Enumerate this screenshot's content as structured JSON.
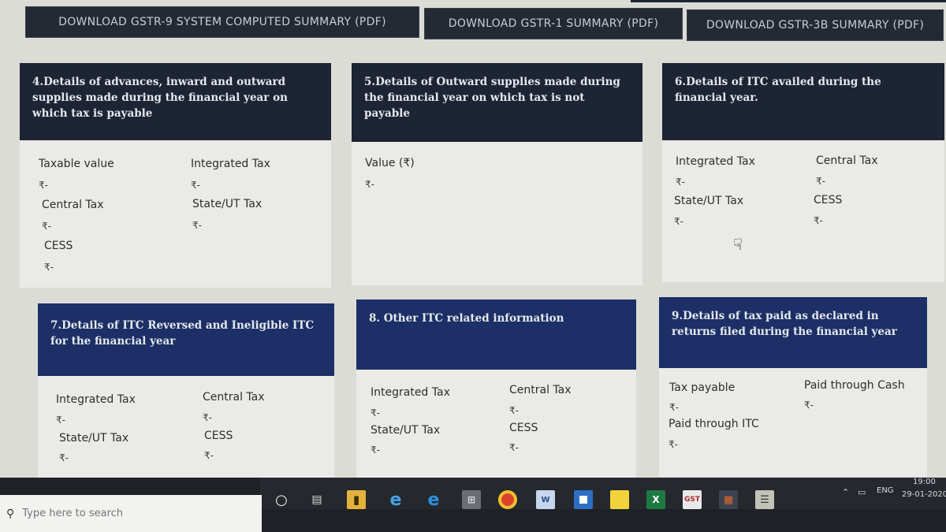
{
  "downloads": {
    "gstr9": "DOWNLOAD GSTR-9 SYSTEM COMPUTED SUMMARY (PDF)",
    "gstr1": "DOWNLOAD GSTR-1 SUMMARY (PDF)",
    "gstr3b": "DOWNLOAD GSTR-3B SUMMARY (PDF)"
  },
  "cards": {
    "c4": {
      "title": "4.Details of advances, inward and outward supplies made during the financial year on which tax is payable",
      "fields": {
        "taxable_value": "Taxable value",
        "taxable_value_amt": "₹-",
        "integrated_tax": "Integrated Tax",
        "integrated_tax_amt": "₹-",
        "central_tax": "Central Tax",
        "central_tax_amt": "₹-",
        "state_ut_tax": "State/UT Tax",
        "state_ut_tax_amt": "₹-",
        "cess": "CESS",
        "cess_amt": "₹-"
      }
    },
    "c5": {
      "title": "5.Details of Outward supplies made during the financial year on which tax is not payable",
      "fields": {
        "value": "Value (₹)",
        "value_amt": "₹-"
      }
    },
    "c6": {
      "title": "6.Details of ITC availed during the financial year.",
      "fields": {
        "integrated_tax": "Integrated Tax",
        "integrated_tax_amt": "₹-",
        "central_tax": "Central Tax",
        "central_tax_amt": "₹-",
        "state_ut_tax": "State/UT Tax",
        "state_ut_tax_amt": "₹-",
        "cess": "CESS",
        "cess_amt": "₹-"
      }
    },
    "c7": {
      "title": "7.Details of ITC Reversed and Ineligible ITC for the financial year",
      "fields": {
        "integrated_tax": "Integrated Tax",
        "integrated_tax_amt": "₹-",
        "central_tax": "Central Tax",
        "central_tax_amt": "₹-",
        "state_ut_tax": "State/UT Tax",
        "state_ut_tax_amt": "₹-",
        "cess": "CESS",
        "cess_amt": "₹-"
      }
    },
    "c8": {
      "title": "8. Other ITC related information",
      "fields": {
        "integrated_tax": "Integrated Tax",
        "integrated_tax_amt": "₹-",
        "central_tax": "Central Tax",
        "central_tax_amt": "₹-",
        "state_ut_tax": "State/UT Tax",
        "state_ut_tax_amt": "₹-",
        "cess": "CESS",
        "cess_amt": "₹-"
      }
    },
    "c9": {
      "title": "9.Details of tax paid as declared in returns filed during the financial year",
      "fields": {
        "tax_payable": "Tax payable",
        "tax_payable_amt": "₹-",
        "paid_cash": "Paid through Cash",
        "paid_cash_amt": "₹-",
        "paid_itc": "Paid through ITC",
        "paid_itc_amt": "₹-"
      }
    }
  },
  "taskbar": {
    "search_placeholder": "Type here to search",
    "lang": "ENG",
    "time": "19:00",
    "date": "29-01-2020",
    "apps": [
      "cortana-icon",
      "task-view-icon",
      "file-explorer-icon",
      "ie-icon",
      "edge-icon",
      "calculator-icon",
      "chrome-icon",
      "word-icon",
      "app-icon",
      "sticky-notes-icon",
      "excel-icon",
      "gst-app-icon",
      "store-icon",
      "reader-icon"
    ]
  },
  "colors": {
    "header_dark": "#1d2434",
    "header_blue": "#1c2f66",
    "button_bg": "#232a33"
  }
}
